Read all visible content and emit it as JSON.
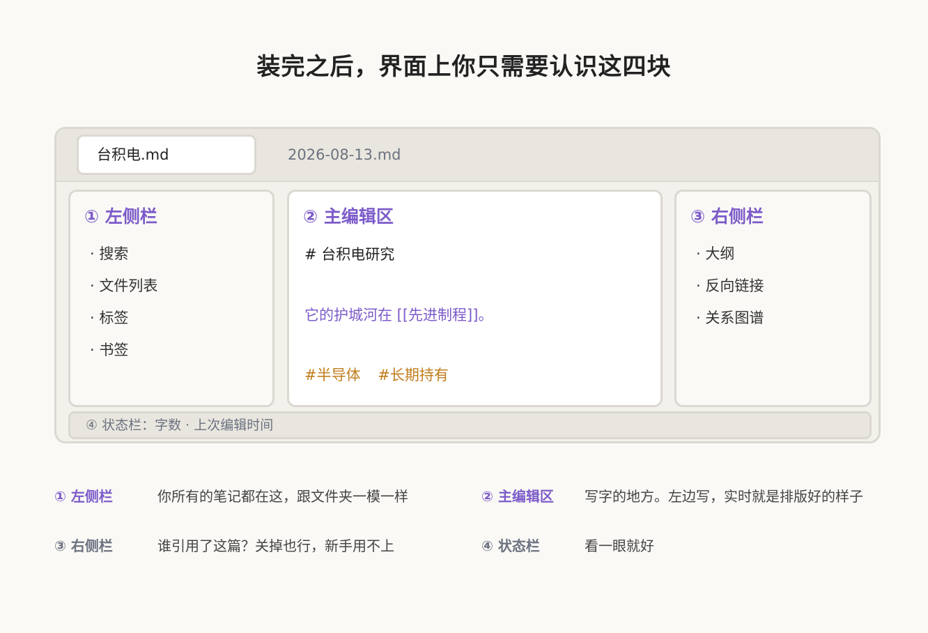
{
  "title": "装完之后，界面上你只需要认识这四块",
  "tabs": [
    {
      "label": "台积电.md",
      "active": true
    },
    {
      "label": "2026-08-13.md",
      "active": false
    }
  ],
  "left_sidebar": {
    "title": "① 左侧栏",
    "items": [
      "· 搜索",
      "· 文件列表",
      "· 标签",
      "· 书签"
    ]
  },
  "main_editor": {
    "title": "② 主编辑区",
    "heading": "# 台积电研究",
    "link_line": "它的护城河在 [[先进制程]]。",
    "tags": [
      "#半导体",
      "#长期持有"
    ]
  },
  "right_sidebar": {
    "title": "③ 右侧栏",
    "items": [
      "· 大纲",
      "· 反向链接",
      "· 关系图谱"
    ]
  },
  "status_bar": {
    "text": "④ 状态栏：字数 · 上次编辑时间"
  },
  "legend": [
    {
      "label": "① 左侧栏",
      "desc": "你所有的笔记都在这，跟文件夹一模一样"
    },
    {
      "label": "② 主编辑区",
      "desc": "写字的地方。左边写，实时就是排版好的样子"
    },
    {
      "label": "③ 右侧栏",
      "desc": "谁引用了这篇？关掉也行，新手用不上"
    },
    {
      "label": "④ 状态栏",
      "desc": "看一眼就好"
    }
  ],
  "colors": {
    "accent": "#7c5bc9",
    "tag": "#c17d1c",
    "muted": "#6b7280",
    "border": "#dbd8d1",
    "background": "#faf9f6"
  }
}
